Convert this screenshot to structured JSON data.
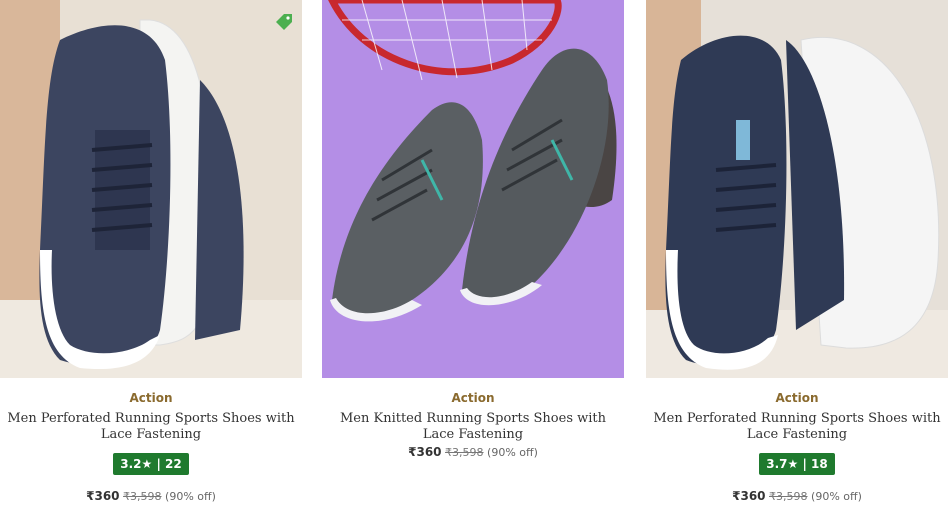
{
  "products": [
    {
      "brand": "Action",
      "title": "Men Perforated Running Sports Shoes with Lace Fastening",
      "rating": "3.2★ | 22",
      "price": "₹360",
      "mrp": "₹3,598",
      "discount": "(90% off)",
      "icon": "price-tag-icon",
      "bg_color": "#e8e0d4",
      "shoe_color": "#3c4560"
    },
    {
      "brand": "Action",
      "title": "Men Knitted Running Sports Shoes with Lace Fastening",
      "price": "₹360",
      "mrp": "₹3,598",
      "discount": "(90% off)",
      "bg_color": "#b48ee6",
      "shoe_color": "#555a5e"
    },
    {
      "brand": "Action",
      "title": "Men Perforated Running Sports Shoes with Lace Fastening",
      "rating": "3.7★ | 18",
      "price": "₹360",
      "mrp": "₹3,598",
      "discount": "(90% off)",
      "bg_color": "#e6e0d8",
      "shoe_color": "#2f3a55"
    }
  ],
  "colors": {
    "rating_green": "#1f7a2e",
    "brand_gold": "#8a6a2e"
  }
}
